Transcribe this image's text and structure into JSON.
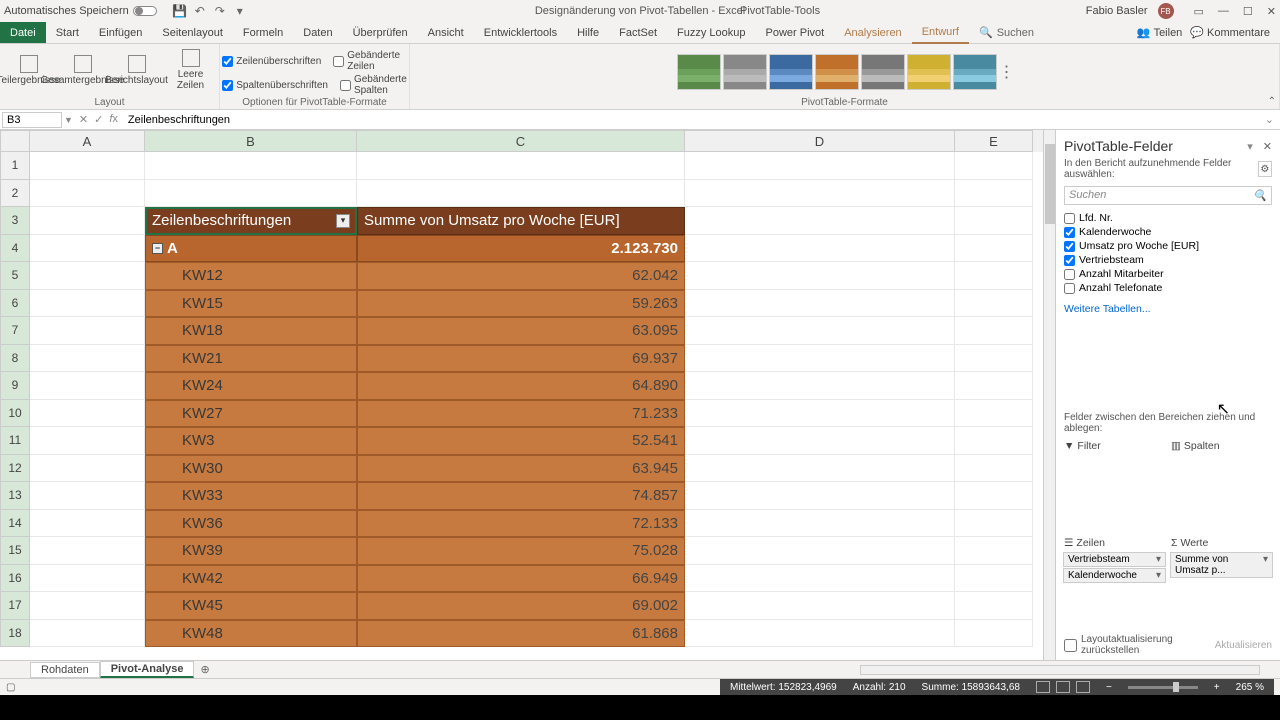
{
  "titlebar": {
    "autosave": "Automatisches Speichern",
    "doc_title": "Designänderung von Pivot-Tabellen - Excel",
    "tools_title": "PivotTable-Tools",
    "user": "Fabio Basler",
    "user_initials": "FB"
  },
  "ribbon_tabs": {
    "file": "Datei",
    "tabs": [
      "Start",
      "Einfügen",
      "Seitenlayout",
      "Formeln",
      "Daten",
      "Überprüfen",
      "Ansicht",
      "Entwicklertools",
      "Hilfe",
      "FactSet",
      "Fuzzy Lookup",
      "Power Pivot"
    ],
    "context_tabs": {
      "analyze": "Analysieren",
      "design": "Entwurf"
    },
    "search": "Suchen",
    "share": "Teilen",
    "comments": "Kommentare"
  },
  "ribbon": {
    "layout": {
      "subtotals": "Teilergebnisse",
      "grandtotals": "Gesamtergebnisse",
      "reportlayout": "Berichtslayout",
      "blankrows": "Leere Zeilen",
      "group": "Layout"
    },
    "options": {
      "row_headers": "Zeilenüberschriften",
      "col_headers": "Spaltenüberschriften",
      "banded_rows": "Gebänderte Zeilen",
      "banded_cols": "Gebänderte Spalten",
      "group": "Optionen für PivotTable-Formate"
    },
    "styles_group": "PivotTable-Formate"
  },
  "formula": {
    "cell_ref": "B3",
    "value": "Zeilenbeschriftungen"
  },
  "columns": [
    "A",
    "B",
    "C",
    "D",
    "E"
  ],
  "pivot": {
    "row_label_header": "Zeilenbeschriftungen",
    "value_header": "Summe von Umsatz pro Woche [EUR]",
    "group_label": "A",
    "group_total": "2.123.730",
    "rows": [
      {
        "label": "KW12",
        "value": "62.042"
      },
      {
        "label": "KW15",
        "value": "59.263"
      },
      {
        "label": "KW18",
        "value": "63.095"
      },
      {
        "label": "KW21",
        "value": "69.937"
      },
      {
        "label": "KW24",
        "value": "64.890"
      },
      {
        "label": "KW27",
        "value": "71.233"
      },
      {
        "label": "KW3",
        "value": "52.541"
      },
      {
        "label": "KW30",
        "value": "63.945"
      },
      {
        "label": "KW33",
        "value": "74.857"
      },
      {
        "label": "KW36",
        "value": "72.133"
      },
      {
        "label": "KW39",
        "value": "75.028"
      },
      {
        "label": "KW42",
        "value": "66.949"
      },
      {
        "label": "KW45",
        "value": "69.002"
      },
      {
        "label": "KW48",
        "value": "61.868"
      }
    ]
  },
  "sheets": {
    "raw": "Rohdaten",
    "analysis": "Pivot-Analyse"
  },
  "field_pane": {
    "title": "PivotTable-Felder",
    "subtitle": "In den Bericht aufzunehmende Felder auswählen:",
    "search_placeholder": "Suchen",
    "fields": [
      {
        "name": "Lfd. Nr.",
        "checked": false
      },
      {
        "name": "Kalenderwoche",
        "checked": true
      },
      {
        "name": "Umsatz pro Woche [EUR]",
        "checked": true
      },
      {
        "name": "Vertriebsteam",
        "checked": true
      },
      {
        "name": "Anzahl Mitarbeiter",
        "checked": false
      },
      {
        "name": "Anzahl Telefonate",
        "checked": false
      }
    ],
    "more_tables": "Weitere Tabellen...",
    "drag_label": "Felder zwischen den Bereichen ziehen und ablegen:",
    "areas": {
      "filter": "Filter",
      "columns": "Spalten",
      "rows": "Zeilen",
      "values": "Werte"
    },
    "row_items": [
      "Vertriebsteam",
      "Kalenderwoche"
    ],
    "value_items": [
      "Summe von Umsatz p..."
    ],
    "defer": "Layoutaktualisierung zurückstellen",
    "update": "Aktualisieren"
  },
  "status": {
    "avg": "Mittelwert: 152823,4969",
    "count": "Anzahl: 210",
    "sum": "Summe: 15893643,68",
    "zoom": "265 %"
  },
  "style_colors": [
    [
      "#5a8a4a",
      "#5a8a4a",
      "#6aa05a",
      "#7ab06a",
      "#5a8a4a"
    ],
    [
      "#888",
      "#888",
      "#aaa",
      "#bbb",
      "#888"
    ],
    [
      "#3a6aa0",
      "#3a6aa0",
      "#5a8ac0",
      "#7aaae0",
      "#3a6aa0"
    ],
    [
      "#c0702a",
      "#c0702a",
      "#d0904a",
      "#e0b06a",
      "#c0702a"
    ],
    [
      "#777",
      "#777",
      "#999",
      "#bbb",
      "#777"
    ],
    [
      "#d0b030",
      "#d0b030",
      "#e0c050",
      "#f0d070",
      "#d0b030"
    ],
    [
      "#4a8aa0",
      "#4a8aa0",
      "#6aaac0",
      "#8acae0",
      "#4a8aa0"
    ]
  ]
}
